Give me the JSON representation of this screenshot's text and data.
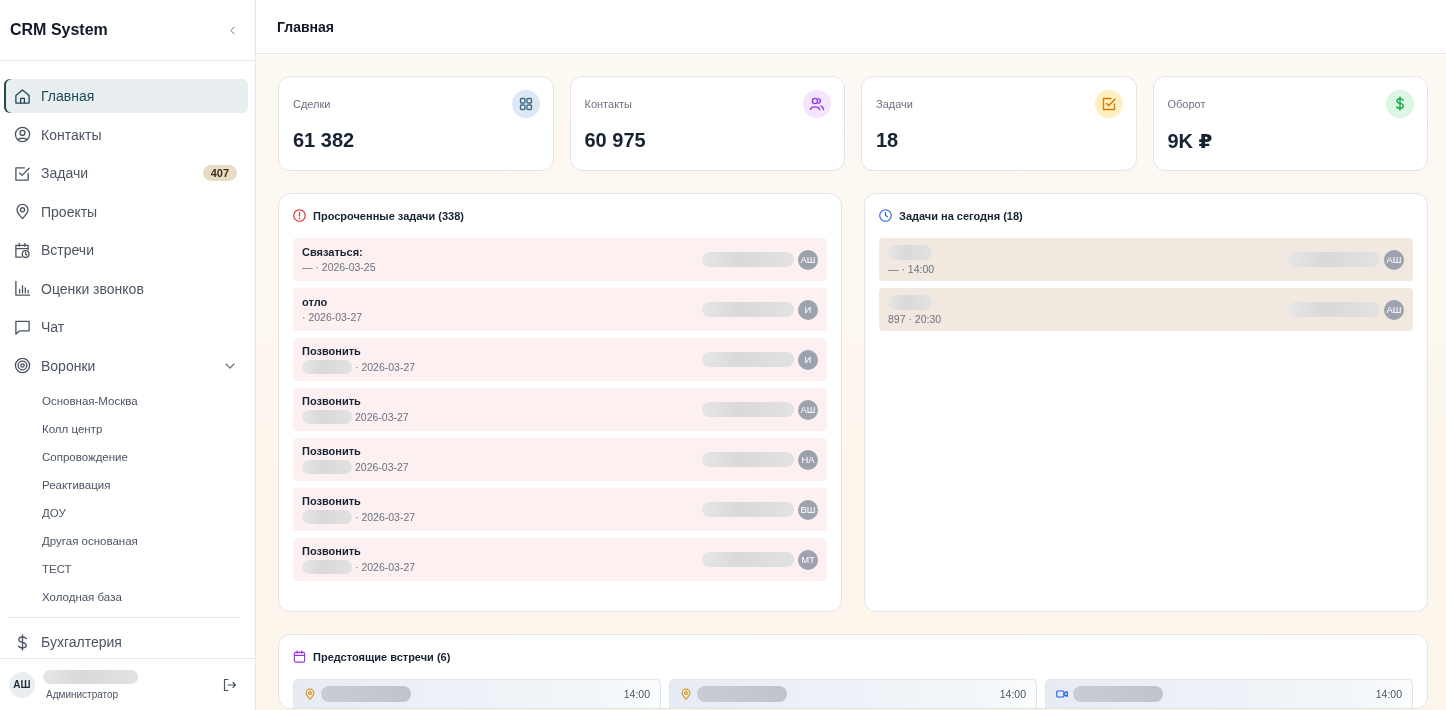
{
  "sidebar": {
    "logo": "CRM System",
    "nav": [
      {
        "kind": "home",
        "label": "Главная",
        "selected": true
      },
      {
        "kind": "user",
        "label": "Контакты",
        "selected": false
      },
      {
        "kind": "check",
        "label": "Задачи",
        "selected": false,
        "badge": "407"
      },
      {
        "kind": "pin",
        "label": "Проекты",
        "selected": false
      },
      {
        "kind": "calendar",
        "label": "Встречи",
        "selected": false
      },
      {
        "kind": "chart",
        "label": "Оценки звонков",
        "selected": false
      },
      {
        "kind": "chat",
        "label": "Чат",
        "selected": false
      },
      {
        "kind": "target",
        "label": "Воронки",
        "selected": false,
        "expanded": true,
        "children": [
          {
            "label": "Основная-Москва"
          },
          {
            "label": "Колл центр"
          },
          {
            "label": "Сопровождение"
          },
          {
            "label": "Реактивация"
          },
          {
            "label": "ДОУ"
          },
          {
            "label": "Другая основаная"
          },
          {
            "label": "ТЕСТ"
          },
          {
            "label": "Холодная база"
          }
        ]
      },
      {
        "kind": "dollar",
        "label": "Бухгалтерия",
        "selected": false
      }
    ],
    "user": {
      "initials": "АШ",
      "role": "Администратор"
    }
  },
  "header": {
    "title": "Главная"
  },
  "stats": [
    {
      "kind": "grid",
      "label": "Сделки",
      "value": "61 382"
    },
    {
      "kind": "users",
      "label": "Контакты",
      "value": "60 975"
    },
    {
      "kind": "task",
      "label": "Задачи",
      "value": "18"
    },
    {
      "kind": "dollar",
      "label": "Оборот",
      "value": "9K ₽"
    }
  ],
  "overdue": {
    "title": "Просроченные задачи (338)",
    "rows": [
      {
        "title": "Связаться:",
        "meta": "— · 2026-03-25",
        "contact_blurred": false,
        "initials": "АШ"
      },
      {
        "title": "отло",
        "meta": "· 2026-03-27",
        "contact_blurred": false,
        "initials": "И"
      },
      {
        "title": "Позвонить",
        "meta": "· 2026-03-27",
        "contact_blurred": true,
        "initials": "И"
      },
      {
        "title": "Позвонить",
        "meta": "2026-03-27",
        "contact_blurred": true,
        "initials": "АШ"
      },
      {
        "title": "Позвонить",
        "meta": "2026-03-27",
        "contact_blurred": true,
        "initials": "НА"
      },
      {
        "title": "Позвонить",
        "meta": "· 2026-03-27",
        "contact_blurred": true,
        "initials": "ВШ"
      },
      {
        "title": "Позвонить",
        "meta": "· 2026-03-27",
        "contact_blurred": true,
        "initials": "МТ"
      }
    ]
  },
  "today": {
    "title": "Задачи на сегодня (18)",
    "rows": [
      {
        "meta": "— · 14:00",
        "initials": "АШ"
      },
      {
        "meta": "897 · 20:30",
        "initials": "АШ"
      }
    ]
  },
  "meetings": {
    "title": "Предстоящие встречи (6)",
    "items": [
      {
        "kind": "place",
        "time": "14:00"
      },
      {
        "kind": "place",
        "time": "14:00"
      },
      {
        "kind": "video",
        "time": "14:00"
      }
    ]
  }
}
